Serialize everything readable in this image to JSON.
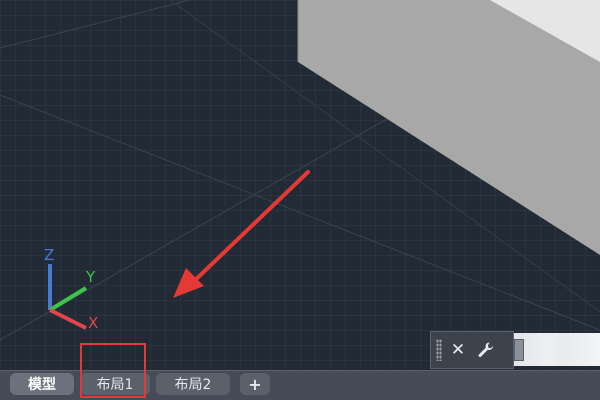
{
  "viewport": {
    "background": "#222a35",
    "solid_top_color": "#e6e6e6",
    "solid_side_color": "#a8a8a8",
    "arrow_color": "#e53935"
  },
  "ucs": {
    "z_label": "Z",
    "y_label": "Y",
    "x_label": "X",
    "z_color": "#4a7bd4",
    "y_color": "#3ec34c",
    "x_color": "#e0474c"
  },
  "command_line": {
    "close_icon": "close-icon",
    "settings_icon": "wrench-icon",
    "input_value": ""
  },
  "tabs": [
    {
      "label": "模型",
      "active": true
    },
    {
      "label": "布局1",
      "active": false
    },
    {
      "label": "布局2",
      "active": false
    },
    {
      "label": "+",
      "active": false
    }
  ],
  "annotation": {
    "highlight_color": "#e53935"
  }
}
